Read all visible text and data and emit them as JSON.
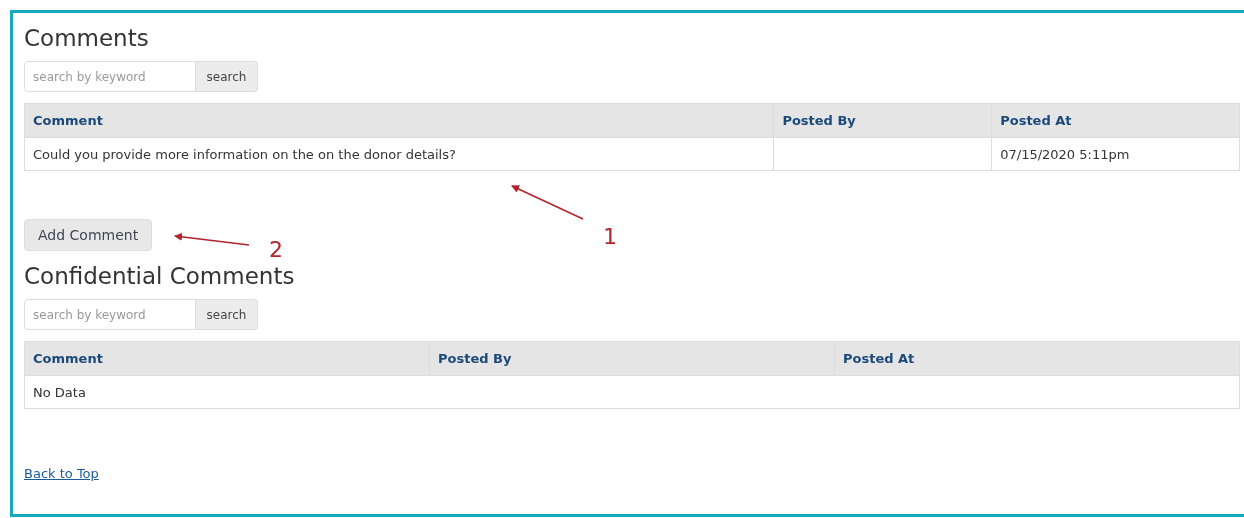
{
  "sections": [
    {
      "title": "Comments",
      "search": {
        "placeholder": "search by keyword",
        "button": "search"
      },
      "table": {
        "columns": [
          "Comment",
          "Posted By",
          "Posted At"
        ],
        "rows": [
          [
            "Could you provide more information on the on the donor details?",
            "",
            "07/15/2020 5:11pm"
          ]
        ]
      },
      "add_button": "Add Comment"
    },
    {
      "title": "Confidential Comments",
      "search": {
        "placeholder": "search by keyword",
        "button": "search"
      },
      "table": {
        "columns": [
          "Comment",
          "Posted By",
          "Posted At"
        ],
        "empty_text": "No Data"
      }
    }
  ],
  "back_link": "Back to Top",
  "annotations": [
    {
      "label": "1"
    },
    {
      "label": "2"
    }
  ]
}
